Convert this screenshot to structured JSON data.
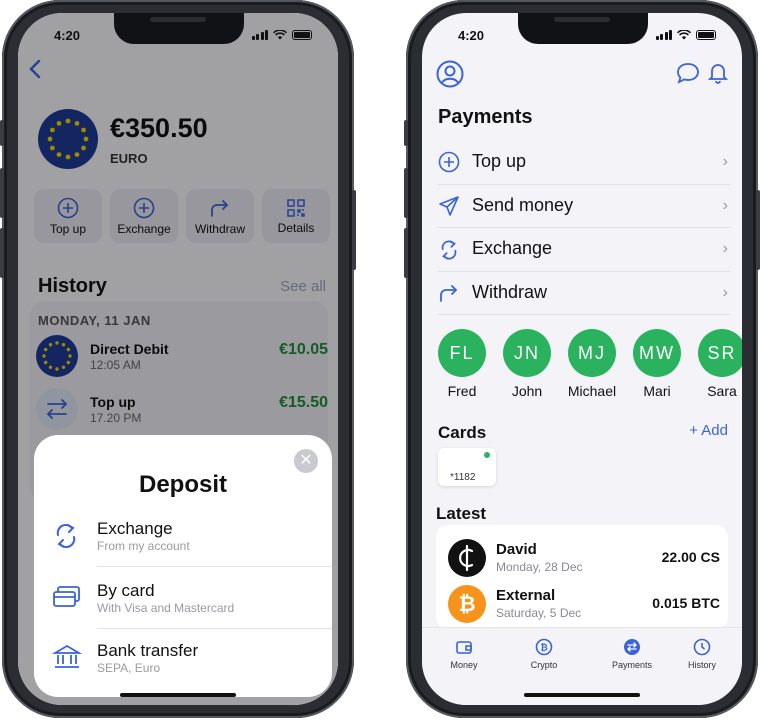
{
  "status_bar": {
    "time": "4:20"
  },
  "left_screen": {
    "account": {
      "balance": "€350.50",
      "currency": "EURO"
    },
    "actions": [
      {
        "label": "Top up",
        "icon": "plus-circle-icon"
      },
      {
        "label": "Exchange",
        "icon": "plus-circle-icon"
      },
      {
        "label": "Withdraw",
        "icon": "share-arrow-icon"
      },
      {
        "label": "Details",
        "icon": "qr-code-icon"
      }
    ],
    "history": {
      "title": "History",
      "see_all": "See all",
      "date": "MONDAY,  11 JAN",
      "transactions": [
        {
          "name": "Direct Debit",
          "time": "12:05 AM",
          "amount": "€10.05"
        },
        {
          "name": "Top up",
          "time": "17.20 PM",
          "amount": "€15.50"
        }
      ]
    },
    "deposit_sheet": {
      "title": "Deposit",
      "options": [
        {
          "title": "Exchange",
          "subtitle": "From my account",
          "icon": "exchange-arrows-icon"
        },
        {
          "title": "By card",
          "subtitle": "With Visa and Mastercard",
          "icon": "credit-card-icon"
        },
        {
          "title": "Bank transfer",
          "subtitle": "SEPA, Euro",
          "icon": "bank-icon"
        }
      ]
    }
  },
  "right_screen": {
    "title": "Payments",
    "menu": [
      {
        "label": "Top up",
        "icon": "plus-circle-icon"
      },
      {
        "label": "Send money",
        "icon": "send-icon"
      },
      {
        "label": "Exchange",
        "icon": "exchange-arrows-icon"
      },
      {
        "label": "Withdraw",
        "icon": "share-arrow-icon"
      }
    ],
    "contacts": [
      {
        "initials": "FL",
        "name": "Fred"
      },
      {
        "initials": "JN",
        "name": "John"
      },
      {
        "initials": "MJ",
        "name": "Michael"
      },
      {
        "initials": "MW",
        "name": "Mari"
      },
      {
        "initials": "SR",
        "name": "Sara"
      }
    ],
    "cards": {
      "title": "Cards",
      "add_label": "+ Add",
      "card_number": "*1182"
    },
    "latest": {
      "title": "Latest",
      "items": [
        {
          "name": "David",
          "date": "Monday, 28 Dec",
          "amount": "22.00 CS",
          "icon": "coin-cs-icon"
        },
        {
          "name": "External",
          "date": "Saturday, 5 Dec",
          "amount": "0.015 BTC",
          "icon": "bitcoin-icon"
        }
      ]
    },
    "tabs": [
      {
        "label": "Money",
        "icon": "wallet-icon"
      },
      {
        "label": "Crypto",
        "icon": "bitcoin-outline-icon"
      },
      {
        "label": "Payments",
        "icon": "payments-icon"
      },
      {
        "label": "History",
        "icon": "clock-icon"
      }
    ]
  },
  "colors": {
    "accent": "#3a63d8",
    "positive": "#1f8a3a",
    "avatar": "#2bb25f",
    "bitcoin": "#f7931a"
  }
}
